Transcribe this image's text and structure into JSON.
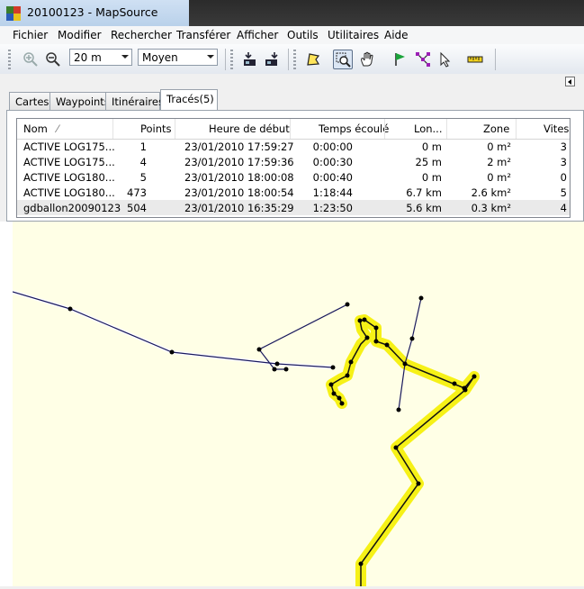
{
  "window": {
    "title": "20100123 - MapSource"
  },
  "menu": [
    "Fichier",
    "Modifier",
    "Rechercher",
    "Transférer",
    "Afficher",
    "Outils",
    "Utilitaires",
    "Aide"
  ],
  "toolbar": {
    "zoom_value": "20 m",
    "detail_value": "Moyen",
    "icons": [
      "zoom-in-icon",
      "zoom-out-icon",
      "receive-from-device-icon",
      "send-to-device-icon",
      "map-tool-icon",
      "zoom-tool-icon",
      "pan-hand-icon",
      "waypoint-flag-icon",
      "route-tool-icon",
      "select-pointer-icon",
      "distance-ruler-icon"
    ]
  },
  "tabs": [
    "Cartes",
    "Waypoints",
    "Itinéraires",
    "Tracés(5)"
  ],
  "selected_tab": "Tracés(5)",
  "table": {
    "columns": [
      "Nom",
      "Points",
      "Heure de début",
      "Temps écoulé",
      "Lon...",
      "Zone",
      "Vitess"
    ],
    "sort_indicator": "⁄",
    "rows": [
      [
        "ACTIVE LOG175...",
        "1",
        "23/01/2010 17:59:27",
        "0:00:00",
        "0 m",
        "0 m²",
        "3"
      ],
      [
        "ACTIVE LOG175...",
        "4",
        "23/01/2010 17:59:36",
        "0:00:30",
        "25 m",
        "2 m²",
        "3"
      ],
      [
        "ACTIVE LOG180...",
        "5",
        "23/01/2010 18:00:08",
        "0:00:40",
        "0 m",
        "0 m²",
        "0"
      ],
      [
        "ACTIVE LOG180...",
        "473",
        "23/01/2010 18:00:54",
        "1:18:44",
        "6.7 km",
        "2.6 km²",
        "5"
      ],
      [
        "gdballon20090123",
        "504",
        "23/01/2010 16:35:29",
        "1:23:50",
        "5.6 km",
        "0.3 km²",
        "4"
      ]
    ],
    "selected_row": 4
  },
  "colors": {
    "map_background": "#ffffe6",
    "track_line": "#1a1a5e",
    "highlight": "#f5f000"
  }
}
